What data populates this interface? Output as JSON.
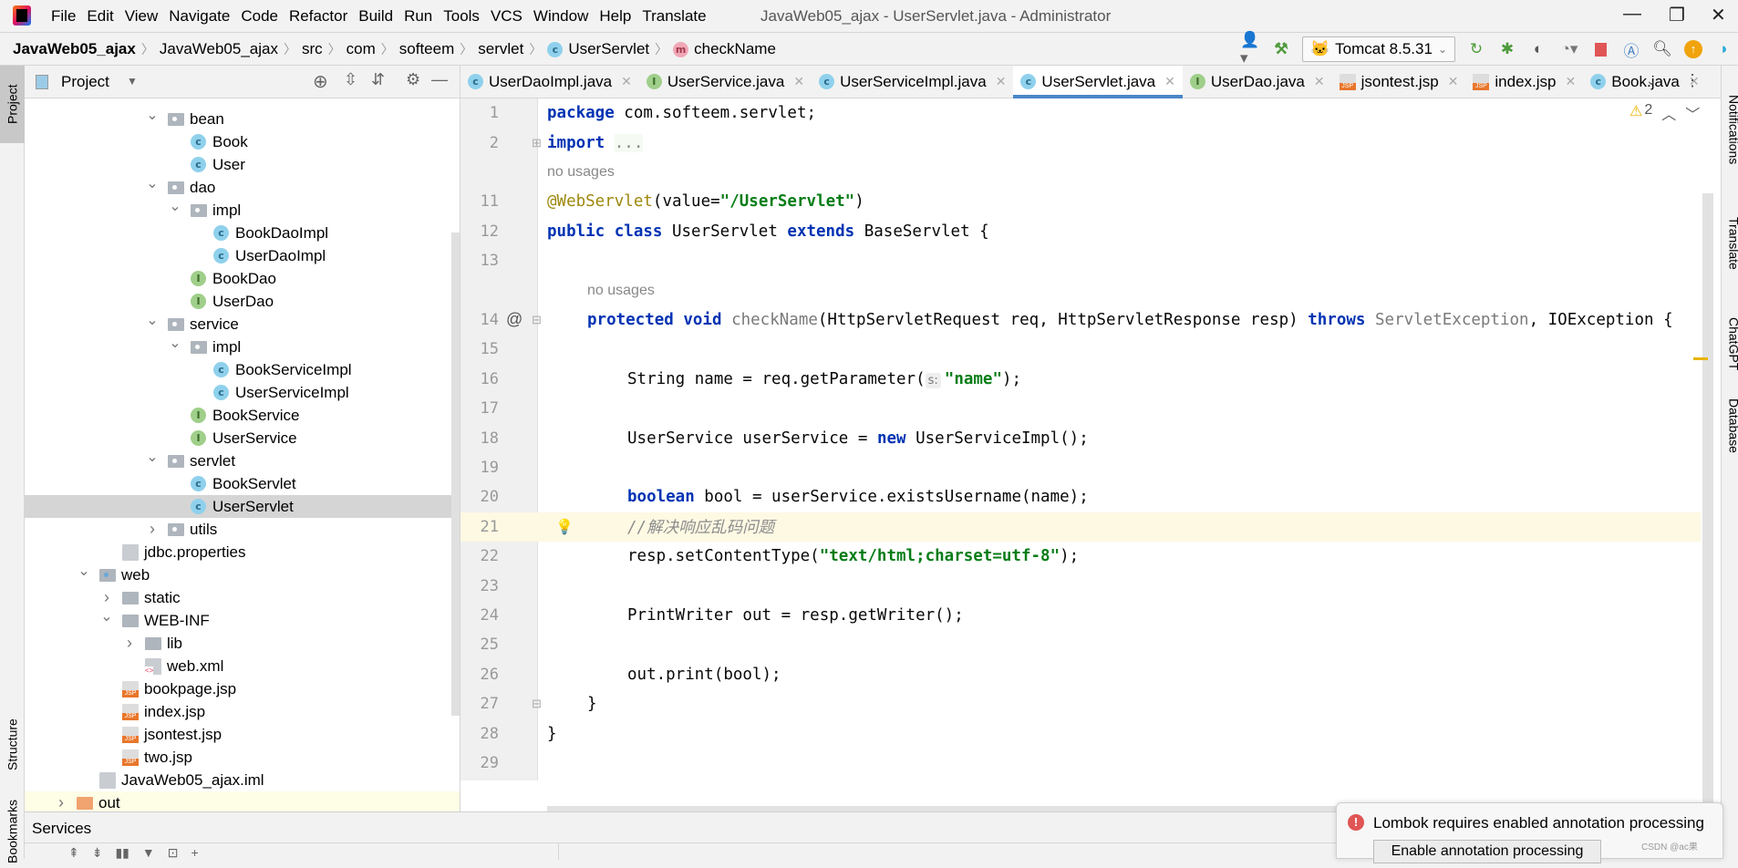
{
  "app": {
    "menu": [
      "File",
      "Edit",
      "View",
      "Navigate",
      "Code",
      "Refactor",
      "Build",
      "Run",
      "Tools",
      "VCS",
      "Window",
      "Help",
      "Translate"
    ],
    "window_title": "JavaWeb05_ajax - UserServlet.java - Administrator"
  },
  "breadcrumb": {
    "project": "JavaWeb05_ajax",
    "items": [
      "JavaWeb05_ajax",
      "src",
      "com",
      "softeem",
      "servlet"
    ],
    "class": "UserServlet",
    "method": "checkName"
  },
  "toolbar": {
    "run_config": "Tomcat 8.5.31"
  },
  "left_strip": {
    "project": "Project",
    "structure": "Structure",
    "bookmarks": "Bookmarks"
  },
  "right_strip": [
    "Notifications",
    "Translate",
    "ChatGPT",
    "Database"
  ],
  "project_panel": {
    "title": "Project",
    "tree": [
      {
        "label": "bean",
        "level": 4,
        "type": "folder",
        "state": "open"
      },
      {
        "label": "Book",
        "level": 5,
        "type": "class"
      },
      {
        "label": "User",
        "level": 5,
        "type": "class"
      },
      {
        "label": "dao",
        "level": 4,
        "type": "folder",
        "state": "open"
      },
      {
        "label": "impl",
        "level": 5,
        "type": "folder",
        "state": "open"
      },
      {
        "label": "BookDaoImpl",
        "level": 6,
        "type": "class"
      },
      {
        "label": "UserDaoImpl",
        "level": 6,
        "type": "class"
      },
      {
        "label": "BookDao",
        "level": 5,
        "type": "interface"
      },
      {
        "label": "UserDao",
        "level": 5,
        "type": "interface"
      },
      {
        "label": "service",
        "level": 4,
        "type": "folder",
        "state": "open"
      },
      {
        "label": "impl",
        "level": 5,
        "type": "folder",
        "state": "open"
      },
      {
        "label": "BookServiceImpl",
        "level": 6,
        "type": "class"
      },
      {
        "label": "UserServiceImpl",
        "level": 6,
        "type": "class"
      },
      {
        "label": "BookService",
        "level": 5,
        "type": "interface"
      },
      {
        "label": "UserService",
        "level": 5,
        "type": "interface"
      },
      {
        "label": "servlet",
        "level": 4,
        "type": "folder",
        "state": "open"
      },
      {
        "label": "BookServlet",
        "level": 5,
        "type": "class"
      },
      {
        "label": "UserServlet",
        "level": 5,
        "type": "class",
        "selected": true
      },
      {
        "label": "utils",
        "level": 4,
        "type": "folder",
        "state": "closed"
      },
      {
        "label": "jdbc.properties",
        "level": 2,
        "type": "properties"
      },
      {
        "label": "web",
        "level": 1,
        "type": "webfolder",
        "state": "open"
      },
      {
        "label": "static",
        "level": 2,
        "type": "plainfolder",
        "state": "closed"
      },
      {
        "label": "WEB-INF",
        "level": 2,
        "type": "plainfolder",
        "state": "open"
      },
      {
        "label": "lib",
        "level": 3,
        "type": "plainfolder",
        "state": "closed"
      },
      {
        "label": "web.xml",
        "level": 3,
        "type": "xml"
      },
      {
        "label": "bookpage.jsp",
        "level": 2,
        "type": "jsp"
      },
      {
        "label": "index.jsp",
        "level": 2,
        "type": "jsp"
      },
      {
        "label": "jsontest.jsp",
        "level": 2,
        "type": "jsp"
      },
      {
        "label": "two.jsp",
        "level": 2,
        "type": "jsp"
      },
      {
        "label": "JavaWeb05_ajax.iml",
        "level": 1,
        "type": "iml"
      },
      {
        "label": "out",
        "level": 0,
        "type": "orangefolder",
        "state": "closed",
        "highlighted": true
      }
    ]
  },
  "editor": {
    "tabs": [
      {
        "label": "UserDaoImpl.java",
        "type": "class"
      },
      {
        "label": "UserService.java",
        "type": "interface"
      },
      {
        "label": "UserServiceImpl.java",
        "type": "class"
      },
      {
        "label": "UserServlet.java",
        "type": "class",
        "active": true
      },
      {
        "label": "UserDao.java",
        "type": "interface"
      },
      {
        "label": "jsontest.jsp",
        "type": "jsp"
      },
      {
        "label": "index.jsp",
        "type": "jsp"
      },
      {
        "label": "Book.java",
        "type": "class"
      }
    ],
    "warnings": "2",
    "lines": [
      {
        "num": "1",
        "indent": 0,
        "tokens": [
          [
            "kw",
            "package"
          ],
          [
            "p",
            " com.softeem.servlet;"
          ]
        ]
      },
      {
        "num": "2",
        "indent": 0,
        "tokens": [
          [
            "kw",
            "import"
          ],
          [
            "p",
            " "
          ],
          [
            "fold",
            "..."
          ]
        ]
      },
      {
        "usage": "no usages",
        "indent": 0
      },
      {
        "num": "11",
        "indent": 0,
        "tokens": [
          [
            "ann",
            "@WebServlet"
          ],
          [
            "p",
            "(value="
          ],
          [
            "str",
            "\"/UserServlet\""
          ],
          [
            "p",
            ")"
          ]
        ]
      },
      {
        "num": "12",
        "indent": 0,
        "tokens": [
          [
            "kw",
            "public class"
          ],
          [
            "p",
            " UserServlet "
          ],
          [
            "kw",
            "extends"
          ],
          [
            "p",
            " BaseServlet {"
          ]
        ]
      },
      {
        "num": "13",
        "indent": 0,
        "tokens": []
      },
      {
        "usage": "no usages",
        "indent": 1
      },
      {
        "num": "14",
        "indent": 1,
        "marker": "@",
        "tokens": [
          [
            "kw",
            "protected void"
          ],
          [
            "p",
            " "
          ],
          [
            "gray",
            "checkName"
          ],
          [
            "p",
            "(HttpServletRequest req, HttpServletResponse resp) "
          ],
          [
            "kw",
            "throws"
          ],
          [
            "p",
            " "
          ],
          [
            "gray",
            "ServletException"
          ],
          [
            "p",
            ", IOException {"
          ]
        ]
      },
      {
        "num": "15",
        "indent": 2,
        "tokens": []
      },
      {
        "num": "16",
        "indent": 2,
        "tokens": [
          [
            "p",
            "String name = req.getParameter("
          ],
          [
            "hint",
            "s:"
          ],
          [
            "str",
            "\"name\""
          ],
          [
            "p",
            ");"
          ]
        ]
      },
      {
        "num": "17",
        "indent": 2,
        "tokens": []
      },
      {
        "num": "18",
        "indent": 2,
        "tokens": [
          [
            "p",
            "UserService userService = "
          ],
          [
            "kw",
            "new"
          ],
          [
            "p",
            " UserServiceImpl();"
          ]
        ]
      },
      {
        "num": "19",
        "indent": 2,
        "tokens": []
      },
      {
        "num": "20",
        "indent": 2,
        "tokens": [
          [
            "kw",
            "boolean"
          ],
          [
            "p",
            " bool = userService.existsUsername(name);"
          ]
        ]
      },
      {
        "num": "21",
        "indent": 2,
        "current": true,
        "bulb": true,
        "tokens": [
          [
            "cmt",
            "//解决响应乱码问题"
          ]
        ]
      },
      {
        "num": "22",
        "indent": 2,
        "tokens": [
          [
            "p",
            "resp.setContentType("
          ],
          [
            "str",
            "\"text/html;charset=utf-8\""
          ],
          [
            "p",
            ");"
          ]
        ]
      },
      {
        "num": "23",
        "indent": 2,
        "tokens": []
      },
      {
        "num": "24",
        "indent": 2,
        "tokens": [
          [
            "p",
            "PrintWriter out = resp.getWriter();"
          ]
        ]
      },
      {
        "num": "25",
        "indent": 2,
        "tokens": []
      },
      {
        "num": "26",
        "indent": 2,
        "tokens": [
          [
            "p",
            "out.print(bool);"
          ]
        ]
      },
      {
        "num": "27",
        "indent": 1,
        "tokens": [
          [
            "p",
            "}"
          ]
        ]
      },
      {
        "num": "28",
        "indent": 0,
        "tokens": [
          [
            "p",
            "}"
          ]
        ]
      },
      {
        "num": "29",
        "indent": 0,
        "tokens": []
      }
    ]
  },
  "services": {
    "title": "Services"
  },
  "notification": {
    "message": "Lombok requires enabled annotation processing",
    "action": "Enable annotation processing"
  },
  "watermark": "CSDN @ac果",
  "colors": {
    "accent": "#4a86c8",
    "keyword": "#0033b3",
    "string": "#067d17",
    "annotation": "#9e880d",
    "error": "#e05555"
  }
}
